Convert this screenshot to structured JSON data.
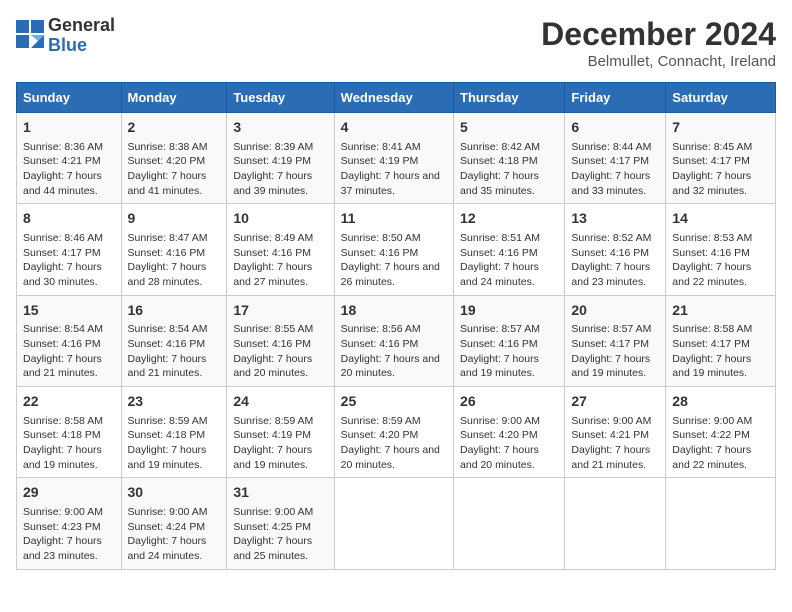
{
  "logo": {
    "general": "General",
    "blue": "Blue"
  },
  "title": "December 2024",
  "subtitle": "Belmullet, Connacht, Ireland",
  "headers": [
    "Sunday",
    "Monday",
    "Tuesday",
    "Wednesday",
    "Thursday",
    "Friday",
    "Saturday"
  ],
  "weeks": [
    [
      {
        "day": "1",
        "sunrise": "Sunrise: 8:36 AM",
        "sunset": "Sunset: 4:21 PM",
        "daylight": "Daylight: 7 hours and 44 minutes."
      },
      {
        "day": "2",
        "sunrise": "Sunrise: 8:38 AM",
        "sunset": "Sunset: 4:20 PM",
        "daylight": "Daylight: 7 hours and 41 minutes."
      },
      {
        "day": "3",
        "sunrise": "Sunrise: 8:39 AM",
        "sunset": "Sunset: 4:19 PM",
        "daylight": "Daylight: 7 hours and 39 minutes."
      },
      {
        "day": "4",
        "sunrise": "Sunrise: 8:41 AM",
        "sunset": "Sunset: 4:19 PM",
        "daylight": "Daylight: 7 hours and 37 minutes."
      },
      {
        "day": "5",
        "sunrise": "Sunrise: 8:42 AM",
        "sunset": "Sunset: 4:18 PM",
        "daylight": "Daylight: 7 hours and 35 minutes."
      },
      {
        "day": "6",
        "sunrise": "Sunrise: 8:44 AM",
        "sunset": "Sunset: 4:17 PM",
        "daylight": "Daylight: 7 hours and 33 minutes."
      },
      {
        "day": "7",
        "sunrise": "Sunrise: 8:45 AM",
        "sunset": "Sunset: 4:17 PM",
        "daylight": "Daylight: 7 hours and 32 minutes."
      }
    ],
    [
      {
        "day": "8",
        "sunrise": "Sunrise: 8:46 AM",
        "sunset": "Sunset: 4:17 PM",
        "daylight": "Daylight: 7 hours and 30 minutes."
      },
      {
        "day": "9",
        "sunrise": "Sunrise: 8:47 AM",
        "sunset": "Sunset: 4:16 PM",
        "daylight": "Daylight: 7 hours and 28 minutes."
      },
      {
        "day": "10",
        "sunrise": "Sunrise: 8:49 AM",
        "sunset": "Sunset: 4:16 PM",
        "daylight": "Daylight: 7 hours and 27 minutes."
      },
      {
        "day": "11",
        "sunrise": "Sunrise: 8:50 AM",
        "sunset": "Sunset: 4:16 PM",
        "daylight": "Daylight: 7 hours and 26 minutes."
      },
      {
        "day": "12",
        "sunrise": "Sunrise: 8:51 AM",
        "sunset": "Sunset: 4:16 PM",
        "daylight": "Daylight: 7 hours and 24 minutes."
      },
      {
        "day": "13",
        "sunrise": "Sunrise: 8:52 AM",
        "sunset": "Sunset: 4:16 PM",
        "daylight": "Daylight: 7 hours and 23 minutes."
      },
      {
        "day": "14",
        "sunrise": "Sunrise: 8:53 AM",
        "sunset": "Sunset: 4:16 PM",
        "daylight": "Daylight: 7 hours and 22 minutes."
      }
    ],
    [
      {
        "day": "15",
        "sunrise": "Sunrise: 8:54 AM",
        "sunset": "Sunset: 4:16 PM",
        "daylight": "Daylight: 7 hours and 21 minutes."
      },
      {
        "day": "16",
        "sunrise": "Sunrise: 8:54 AM",
        "sunset": "Sunset: 4:16 PM",
        "daylight": "Daylight: 7 hours and 21 minutes."
      },
      {
        "day": "17",
        "sunrise": "Sunrise: 8:55 AM",
        "sunset": "Sunset: 4:16 PM",
        "daylight": "Daylight: 7 hours and 20 minutes."
      },
      {
        "day": "18",
        "sunrise": "Sunrise: 8:56 AM",
        "sunset": "Sunset: 4:16 PM",
        "daylight": "Daylight: 7 hours and 20 minutes."
      },
      {
        "day": "19",
        "sunrise": "Sunrise: 8:57 AM",
        "sunset": "Sunset: 4:16 PM",
        "daylight": "Daylight: 7 hours and 19 minutes."
      },
      {
        "day": "20",
        "sunrise": "Sunrise: 8:57 AM",
        "sunset": "Sunset: 4:17 PM",
        "daylight": "Daylight: 7 hours and 19 minutes."
      },
      {
        "day": "21",
        "sunrise": "Sunrise: 8:58 AM",
        "sunset": "Sunset: 4:17 PM",
        "daylight": "Daylight: 7 hours and 19 minutes."
      }
    ],
    [
      {
        "day": "22",
        "sunrise": "Sunrise: 8:58 AM",
        "sunset": "Sunset: 4:18 PM",
        "daylight": "Daylight: 7 hours and 19 minutes."
      },
      {
        "day": "23",
        "sunrise": "Sunrise: 8:59 AM",
        "sunset": "Sunset: 4:18 PM",
        "daylight": "Daylight: 7 hours and 19 minutes."
      },
      {
        "day": "24",
        "sunrise": "Sunrise: 8:59 AM",
        "sunset": "Sunset: 4:19 PM",
        "daylight": "Daylight: 7 hours and 19 minutes."
      },
      {
        "day": "25",
        "sunrise": "Sunrise: 8:59 AM",
        "sunset": "Sunset: 4:20 PM",
        "daylight": "Daylight: 7 hours and 20 minutes."
      },
      {
        "day": "26",
        "sunrise": "Sunrise: 9:00 AM",
        "sunset": "Sunset: 4:20 PM",
        "daylight": "Daylight: 7 hours and 20 minutes."
      },
      {
        "day": "27",
        "sunrise": "Sunrise: 9:00 AM",
        "sunset": "Sunset: 4:21 PM",
        "daylight": "Daylight: 7 hours and 21 minutes."
      },
      {
        "day": "28",
        "sunrise": "Sunrise: 9:00 AM",
        "sunset": "Sunset: 4:22 PM",
        "daylight": "Daylight: 7 hours and 22 minutes."
      }
    ],
    [
      {
        "day": "29",
        "sunrise": "Sunrise: 9:00 AM",
        "sunset": "Sunset: 4:23 PM",
        "daylight": "Daylight: 7 hours and 23 minutes."
      },
      {
        "day": "30",
        "sunrise": "Sunrise: 9:00 AM",
        "sunset": "Sunset: 4:24 PM",
        "daylight": "Daylight: 7 hours and 24 minutes."
      },
      {
        "day": "31",
        "sunrise": "Sunrise: 9:00 AM",
        "sunset": "Sunset: 4:25 PM",
        "daylight": "Daylight: 7 hours and 25 minutes."
      },
      null,
      null,
      null,
      null
    ]
  ]
}
